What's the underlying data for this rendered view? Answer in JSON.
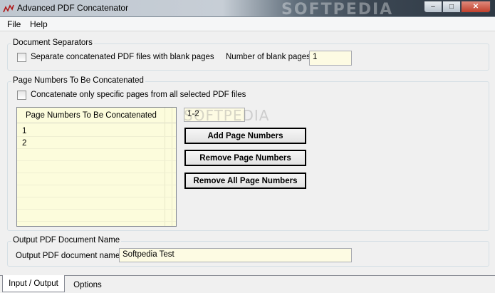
{
  "window": {
    "title": "Advanced PDF Concatenator",
    "watermark": "SOFTPEDIA",
    "controls": {
      "minimize": "–",
      "maximize": "□",
      "close": "✕"
    }
  },
  "menu": {
    "items": [
      "File",
      "Help"
    ]
  },
  "document_separators": {
    "group_title": "Document Separators",
    "checkbox_label": "Separate concatenated PDF files with blank pages",
    "checked": false,
    "blank_pages_label": "Number of blank pages:",
    "blank_pages_value": "1"
  },
  "page_numbers": {
    "group_title": "Page Numbers To Be Concatenated",
    "checkbox_label": "Concatenate only specific pages from all selected PDF files",
    "checked": false,
    "list_header": "Page Numbers To Be Concatenated",
    "list_items": [
      "1",
      "2"
    ],
    "range_input_value": "1-2",
    "watermark": "SOFTPEDIA",
    "add_button": "Add Page Numbers",
    "remove_button": "Remove Page Numbers",
    "remove_all_button": "Remove All Page Numbers"
  },
  "output": {
    "group_title": "Output PDF Document Name",
    "label": "Output PDF document name:",
    "value": "Softpedia Test"
  },
  "tabs": [
    {
      "label": "Input / Output",
      "active": true
    },
    {
      "label": "Options",
      "active": false
    }
  ]
}
